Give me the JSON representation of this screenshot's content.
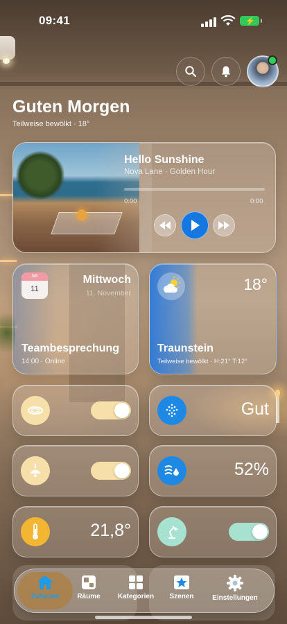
{
  "status_bar": {
    "time": "09:41"
  },
  "header": {
    "greeting": "Guten Morgen",
    "subtitle": "Teilweise bewölkt · 18°",
    "search_icon": "search-icon",
    "bell_icon": "bell-icon",
    "avatar_status_color": "#30d158"
  },
  "media": {
    "song": "Hello Sunshine",
    "artist": "Nova Lane · Golden Hour",
    "time_elapsed": "0:00",
    "time_total": "0:00",
    "progress": 0,
    "accent": "#1577e0"
  },
  "calendar": {
    "icon_month": "MI",
    "icon_day": "11",
    "weekday": "Mittwoch",
    "date": "11. November",
    "event": "Teambesprechung",
    "event_info": "14:00 · Online"
  },
  "weather": {
    "temp": "18°",
    "city": "Traunstein",
    "info": "Teilweise bewölkt · H:21° T:12°",
    "icon": "partly-cloudy-icon"
  },
  "tiles": {
    "ceiling_light": {
      "icon": "ceiling-light-icon",
      "on": true,
      "color": "#f6dfa8"
    },
    "air_quality": {
      "icon": "air-quality-icon",
      "value": "Gut",
      "color": "#1e88e5"
    },
    "pendant_lamp": {
      "icon": "pendant-lamp-icon",
      "on": true,
      "color": "#f6dfa8"
    },
    "humidity": {
      "icon": "humidity-icon",
      "value": "52%",
      "color": "#1e88e5"
    },
    "thermostat": {
      "icon": "thermometer-icon",
      "value": "21,8°",
      "color": "#f2b632"
    },
    "desk_lamp": {
      "icon": "desk-lamp-icon",
      "on": true,
      "color": "#a6e2cf"
    }
  },
  "nav": {
    "items": [
      {
        "label": "Zuhause",
        "icon": "home-icon",
        "active": true
      },
      {
        "label": "Räume",
        "icon": "rooms-icon"
      },
      {
        "label": "Kategorien",
        "icon": "categories-icon"
      },
      {
        "label": "Szenen",
        "icon": "scenes-icon"
      },
      {
        "label": "Einstellungen",
        "icon": "gear-icon"
      }
    ]
  }
}
